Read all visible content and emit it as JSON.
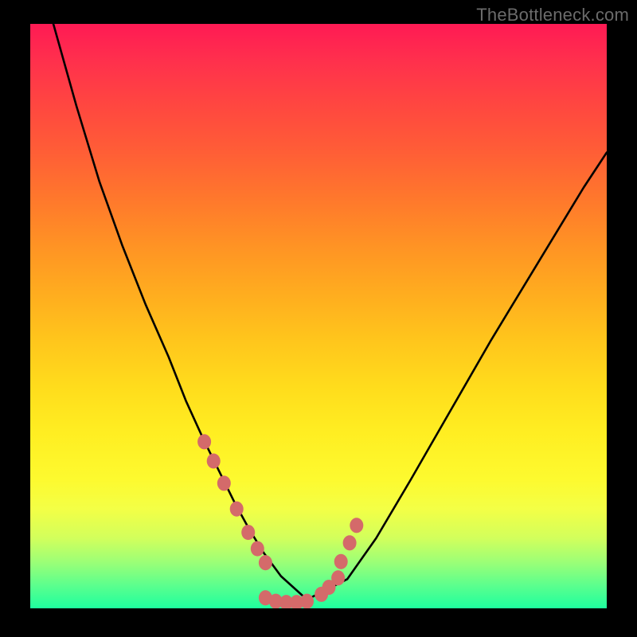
{
  "watermark": "TheBottleneck.com",
  "chart_data": {
    "type": "line",
    "title": "",
    "xlabel": "",
    "ylabel": "",
    "xlim": [
      0,
      100
    ],
    "ylim": [
      0,
      100
    ],
    "grid": false,
    "legend": false,
    "note": "V-shaped bottleneck curve; values are in plot %, top-left origin for y_pct (0=top, 100=bottom).",
    "series": [
      {
        "name": "curve",
        "x_pct": [
          4,
          8,
          12,
          16,
          20,
          24,
          27,
          30,
          33,
          35.5,
          38,
          40.5,
          43.5,
          48,
          55,
          60,
          66,
          73,
          80,
          88,
          96,
          100
        ],
        "y_pct": [
          0,
          14,
          27,
          38,
          48,
          57,
          64.5,
          71,
          77,
          82,
          86.5,
          90.5,
          94.5,
          98.5,
          95,
          88,
          78,
          66,
          54,
          41,
          28,
          22
        ]
      }
    ],
    "flat_bottom": {
      "x_start_pct": 40.5,
      "x_end_pct": 48,
      "y_pct": 98.8
    },
    "markers": {
      "left_cluster": [
        {
          "x_pct": 30.2,
          "y_pct": 71.5
        },
        {
          "x_pct": 31.8,
          "y_pct": 74.8
        },
        {
          "x_pct": 33.6,
          "y_pct": 78.6
        },
        {
          "x_pct": 35.8,
          "y_pct": 83.0
        },
        {
          "x_pct": 37.8,
          "y_pct": 87.0
        },
        {
          "x_pct": 39.4,
          "y_pct": 89.8
        },
        {
          "x_pct": 40.8,
          "y_pct": 92.2
        }
      ],
      "bottom_cluster": [
        {
          "x_pct": 40.8,
          "y_pct": 98.2
        },
        {
          "x_pct": 42.6,
          "y_pct": 98.8
        },
        {
          "x_pct": 44.4,
          "y_pct": 99.0
        },
        {
          "x_pct": 46.2,
          "y_pct": 99.0
        },
        {
          "x_pct": 48.0,
          "y_pct": 98.8
        }
      ],
      "right_cluster": [
        {
          "x_pct": 50.5,
          "y_pct": 97.6
        },
        {
          "x_pct": 51.8,
          "y_pct": 96.4
        },
        {
          "x_pct": 53.4,
          "y_pct": 94.8
        },
        {
          "x_pct": 53.9,
          "y_pct": 92.0
        },
        {
          "x_pct": 55.4,
          "y_pct": 88.8
        },
        {
          "x_pct": 56.6,
          "y_pct": 85.8
        }
      ]
    },
    "colors": {
      "background_frame": "#000000",
      "curve_stroke": "#000000",
      "marker_fill": "#d46a6a",
      "gradient_top": "#ff1a54",
      "gradient_bottom": "#1eff9e"
    }
  }
}
